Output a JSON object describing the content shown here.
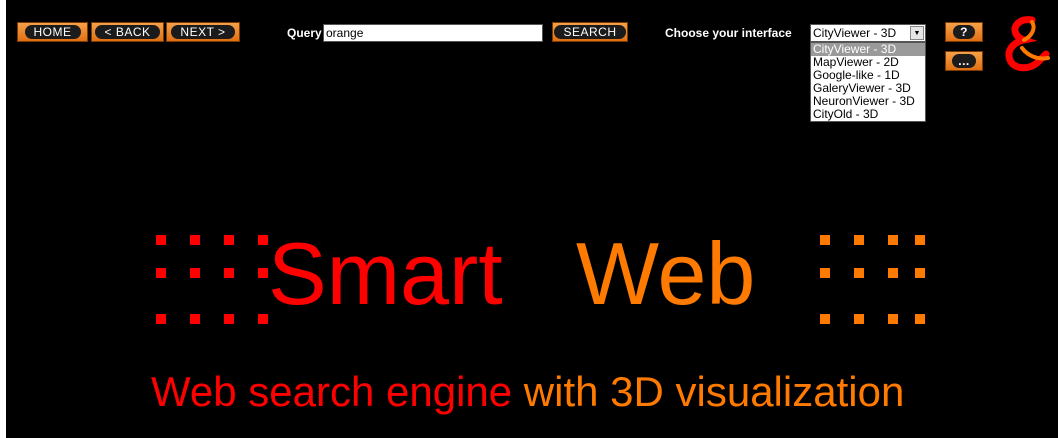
{
  "toolbar": {
    "home_label": "HOME",
    "back_label": "< BACK",
    "next_label": "NEXT >",
    "search_label": "SEARCH",
    "help_label": "?",
    "more_label": "..."
  },
  "query": {
    "label": "Query",
    "value": "orange"
  },
  "interface": {
    "label": "Choose your interface",
    "selected": "CityViewer - 3D",
    "options": [
      "CityViewer - 3D",
      "MapViewer - 2D",
      "Google-like - 1D",
      "GaleryViewer - 3D",
      "NeuronViewer - 3D",
      "CityOld - 3D"
    ]
  },
  "brand": {
    "part1": "Smart",
    "part2": "Web",
    "tagline_part1": "Web search engine ",
    "tagline_part2": "with 3D visualization"
  },
  "colors": {
    "red": "#ff0000",
    "orange": "#ff7a00",
    "background": "#000000"
  },
  "icons": {
    "logo": "ampersand-logo-icon"
  }
}
